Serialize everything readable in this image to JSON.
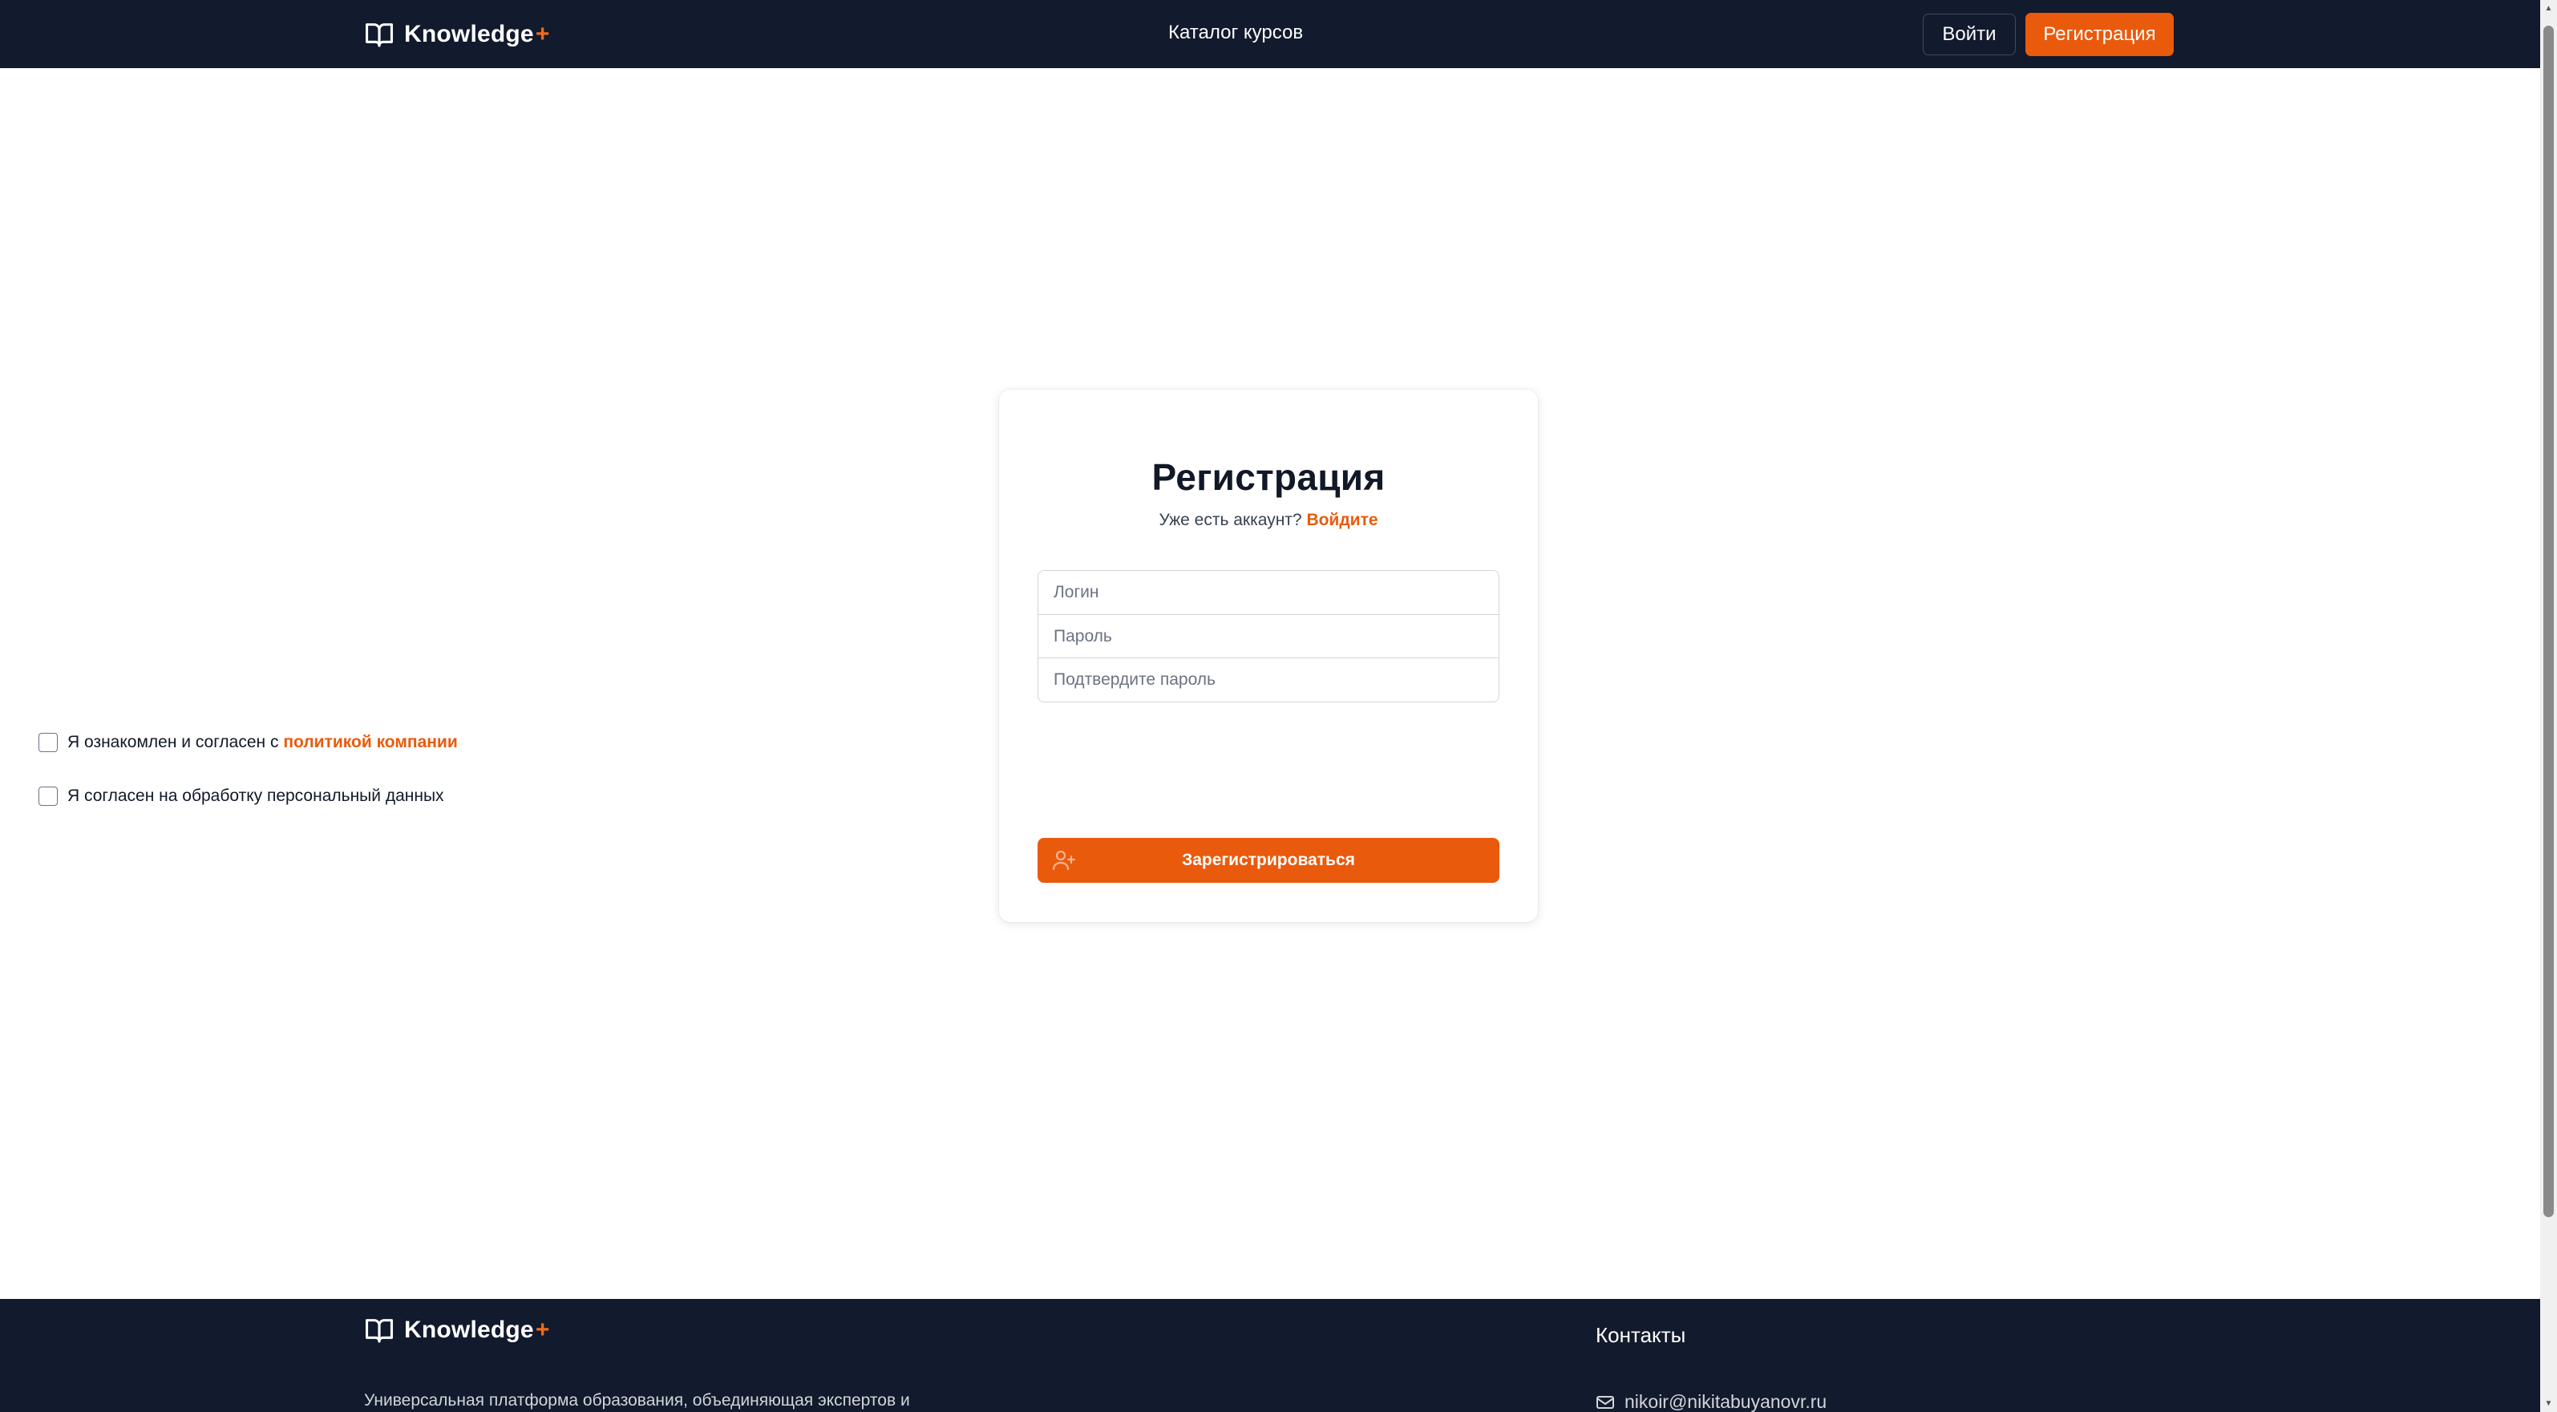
{
  "header": {
    "logo_text": "Knowledge",
    "logo_plus": "+",
    "nav_catalog": "Каталог курсов",
    "login_button": "Войти",
    "register_button": "Регистрация"
  },
  "form": {
    "title": "Регистрация",
    "have_account": "Уже есть аккаунт?",
    "login_link": "Войдите",
    "login_placeholder": "Логин",
    "password_placeholder": "Пароль",
    "confirm_placeholder": "Подтвердите пароль",
    "policy_text": "Я ознакомлен и согласен с",
    "policy_link": "политикой компании",
    "personal_data_text": "Я согласен на обработку персональный данных",
    "submit_label": "Зарегистрироваться"
  },
  "footer": {
    "logo_text": "Knowledge",
    "logo_plus": "+",
    "description": "Универсальная платформа образования, объединяющая экспертов и",
    "contacts_title": "Контакты",
    "email": "nikoir@nikitabuyanovr.ru"
  },
  "colors": {
    "header_bg": "#121a2d",
    "accent": "#ea5a0c",
    "page_bg": "#ffffff"
  },
  "icons": {
    "logo": "book-open-icon",
    "submit": "user-plus-icon",
    "email": "mail-icon"
  }
}
